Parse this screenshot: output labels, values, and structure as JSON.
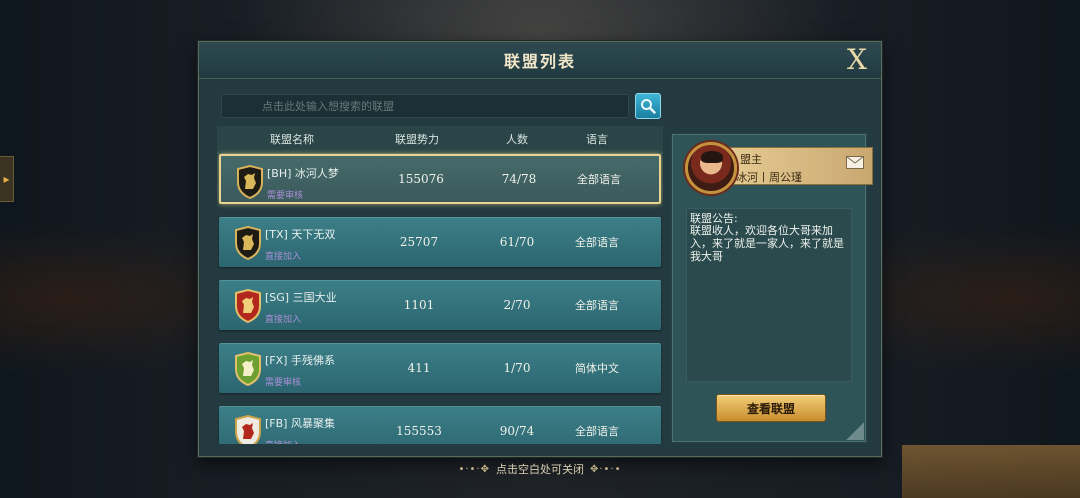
{
  "dialog": {
    "title": "联盟列表",
    "close_label": "X"
  },
  "search": {
    "placeholder": "点击此处输入想搜索的联盟"
  },
  "table": {
    "headers": [
      "联盟名称",
      "联盟势力",
      "人数",
      "语言"
    ],
    "rows": [
      {
        "name": "[BH] 冰河人梦",
        "status": "需要审核",
        "power": "155076",
        "members": "74/78",
        "language": "全部语言",
        "crest": "black-lion",
        "selected": true
      },
      {
        "name": "[TX] 天下无双",
        "status": "直接加入",
        "power": "25707",
        "members": "61/70",
        "language": "全部语言",
        "crest": "black-lion",
        "selected": false
      },
      {
        "name": "[SG] 三国大业",
        "status": "直接加入",
        "power": "1101",
        "members": "2/70",
        "language": "全部语言",
        "crest": "red-lion",
        "selected": false
      },
      {
        "name": "[FX] 手残佛系",
        "status": "需要审核",
        "power": "411",
        "members": "1/70",
        "language": "简体中文",
        "crest": "green-tree",
        "selected": false
      },
      {
        "name": "[FB] 风暴聚集",
        "status": "直接加入",
        "power": "155553",
        "members": "90/74",
        "language": "全部语言",
        "crest": "white-lion",
        "selected": false
      }
    ]
  },
  "info": {
    "leader_title": "盟主",
    "leader_name": "冰河丨周公瑾",
    "notice_label": "联盟公告:",
    "notice_text": "联盟收人，欢迎各位大哥来加入，来了就是一家人，来了就是我大哥",
    "view_button": "查看联盟"
  },
  "hint": "点击空白处可关闭",
  "colors": {
    "accent_gold": "#e8d48e",
    "row_teal": "#3c7f88",
    "status_purple": "#a88fd6"
  }
}
